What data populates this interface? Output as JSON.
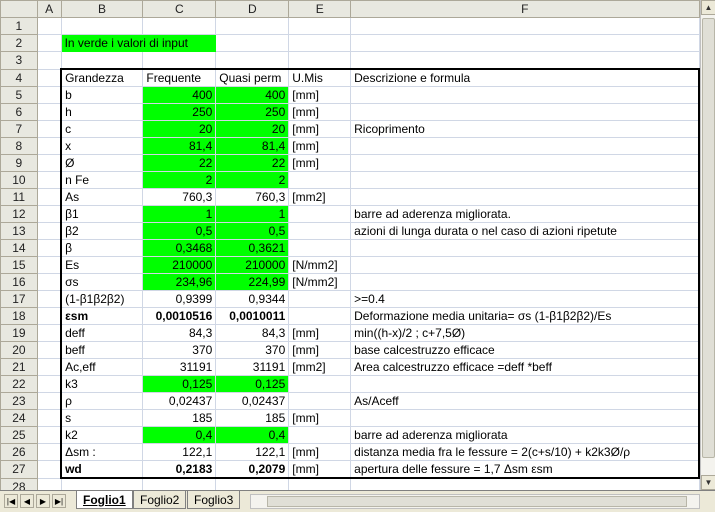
{
  "columns": [
    "A",
    "B",
    "C",
    "D",
    "E",
    "F"
  ],
  "note": "In verde i valori di input",
  "headers": {
    "b": "Grandezza",
    "c": "Frequente",
    "d": "Quasi perm",
    "e": "U.Mis",
    "f": "Descrizione e formula"
  },
  "rows": [
    {
      "n": "5",
      "b": "b",
      "c": "400",
      "d": "400",
      "e": "[mm]",
      "f": "",
      "cg": true,
      "dg": true
    },
    {
      "n": "6",
      "b": "h",
      "c": "250",
      "d": "250",
      "e": "[mm]",
      "f": "",
      "cg": true,
      "dg": true
    },
    {
      "n": "7",
      "b": "c",
      "c": "20",
      "d": "20",
      "e": "[mm]",
      "f": "Ricoprimento",
      "cg": true,
      "dg": true
    },
    {
      "n": "8",
      "b": "x",
      "c": "81,4",
      "d": "81,4",
      "e": "[mm]",
      "f": "",
      "cg": true,
      "dg": true
    },
    {
      "n": "9",
      "b": "Ø",
      "c": "22",
      "d": "22",
      "e": "[mm]",
      "f": "",
      "cg": true,
      "dg": true
    },
    {
      "n": "10",
      "b": "n Fe",
      "c": "2",
      "d": "2",
      "e": "",
      "f": "",
      "cg": true,
      "dg": true
    },
    {
      "n": "11",
      "b": "As",
      "c": "760,3",
      "d": "760,3",
      "e": "[mm2]",
      "f": "",
      "cg": false,
      "dg": false
    },
    {
      "n": "12",
      "b": "β1",
      "c": "1",
      "d": "1",
      "e": "",
      "f": "barre ad aderenza migliorata.",
      "cg": true,
      "dg": true
    },
    {
      "n": "13",
      "b": "β2",
      "c": "0,5",
      "d": "0,5",
      "e": "",
      "f": "azioni di lunga durata o nel caso di azioni ripetute",
      "cg": true,
      "dg": true
    },
    {
      "n": "14",
      "b": "β",
      "c": "0,3468",
      "d": "0,3621",
      "e": "",
      "f": "",
      "cg": true,
      "dg": true
    },
    {
      "n": "15",
      "b": "Es",
      "c": "210000",
      "d": "210000",
      "e": "[N/mm2]",
      "f": "",
      "cg": true,
      "dg": true
    },
    {
      "n": "16",
      "b": "σs",
      "c": "234,96",
      "d": "224,99",
      "e": "[N/mm2]",
      "f": "",
      "cg": true,
      "dg": true
    },
    {
      "n": "17",
      "b": "(1-β1β2β2)",
      "c": "0,9399",
      "d": "0,9344",
      "e": "",
      "f": " >=0.4",
      "cg": false,
      "dg": false
    },
    {
      "n": "18",
      "b": "εsm",
      "c": "0,0010516",
      "d": "0,0010011",
      "e": "",
      "f": "Deformazione media unitaria= σs (1-β1β2β2)/Es",
      "cg": false,
      "dg": false,
      "bold": true
    },
    {
      "n": "19",
      "b": "deff",
      "c": "84,3",
      "d": "84,3",
      "e": "[mm]",
      "f": " min((h-x)/2 ; c+7,5Ø)",
      "cg": false,
      "dg": false
    },
    {
      "n": "20",
      "b": "beff",
      "c": "370",
      "d": "370",
      "e": "[mm]",
      "f": "base calcestruzzo efficace",
      "cg": false,
      "dg": false
    },
    {
      "n": "21",
      "b": "Ac,eff",
      "c": "31191",
      "d": "31191",
      "e": "[mm2]",
      "f": "Area calcestruzzo efficace =deff *beff",
      "cg": false,
      "dg": false
    },
    {
      "n": "22",
      "b": "k3",
      "c": "0,125",
      "d": "0,125",
      "e": "",
      "f": "",
      "cg": true,
      "dg": true
    },
    {
      "n": "23",
      "b": "ρ",
      "c": "0,02437",
      "d": "0,02437",
      "e": "",
      "f": "As/Aceff",
      "cg": false,
      "dg": false
    },
    {
      "n": "24",
      "b": "s",
      "c": "185",
      "d": "185",
      "e": "[mm]",
      "f": "",
      "cg": false,
      "dg": false
    },
    {
      "n": "25",
      "b": "k2",
      "c": "0,4",
      "d": "0,4",
      "e": "",
      "f": "barre ad aderenza migliorata",
      "cg": true,
      "dg": true
    },
    {
      "n": "26",
      "b": "Δsm :",
      "c": "122,1",
      "d": "122,1",
      "e": "[mm]",
      "f": "distanza media fra le fessure = 2(c+s/10) + k2k3Ø/ρ",
      "cg": false,
      "dg": false
    },
    {
      "n": "27",
      "b": "wd",
      "c": "0,2183",
      "d": "0,2079",
      "e": "[mm]",
      "f": "apertura delle fessure = 1,7 Δsm εsm",
      "cg": false,
      "dg": false,
      "bold": true
    }
  ],
  "tabs": [
    "Foglio1",
    "Foglio2",
    "Foglio3"
  ],
  "active_tab": "Foglio1",
  "colors": {
    "input_green": "#00ff00",
    "header_bg": "#e8e8e0"
  }
}
